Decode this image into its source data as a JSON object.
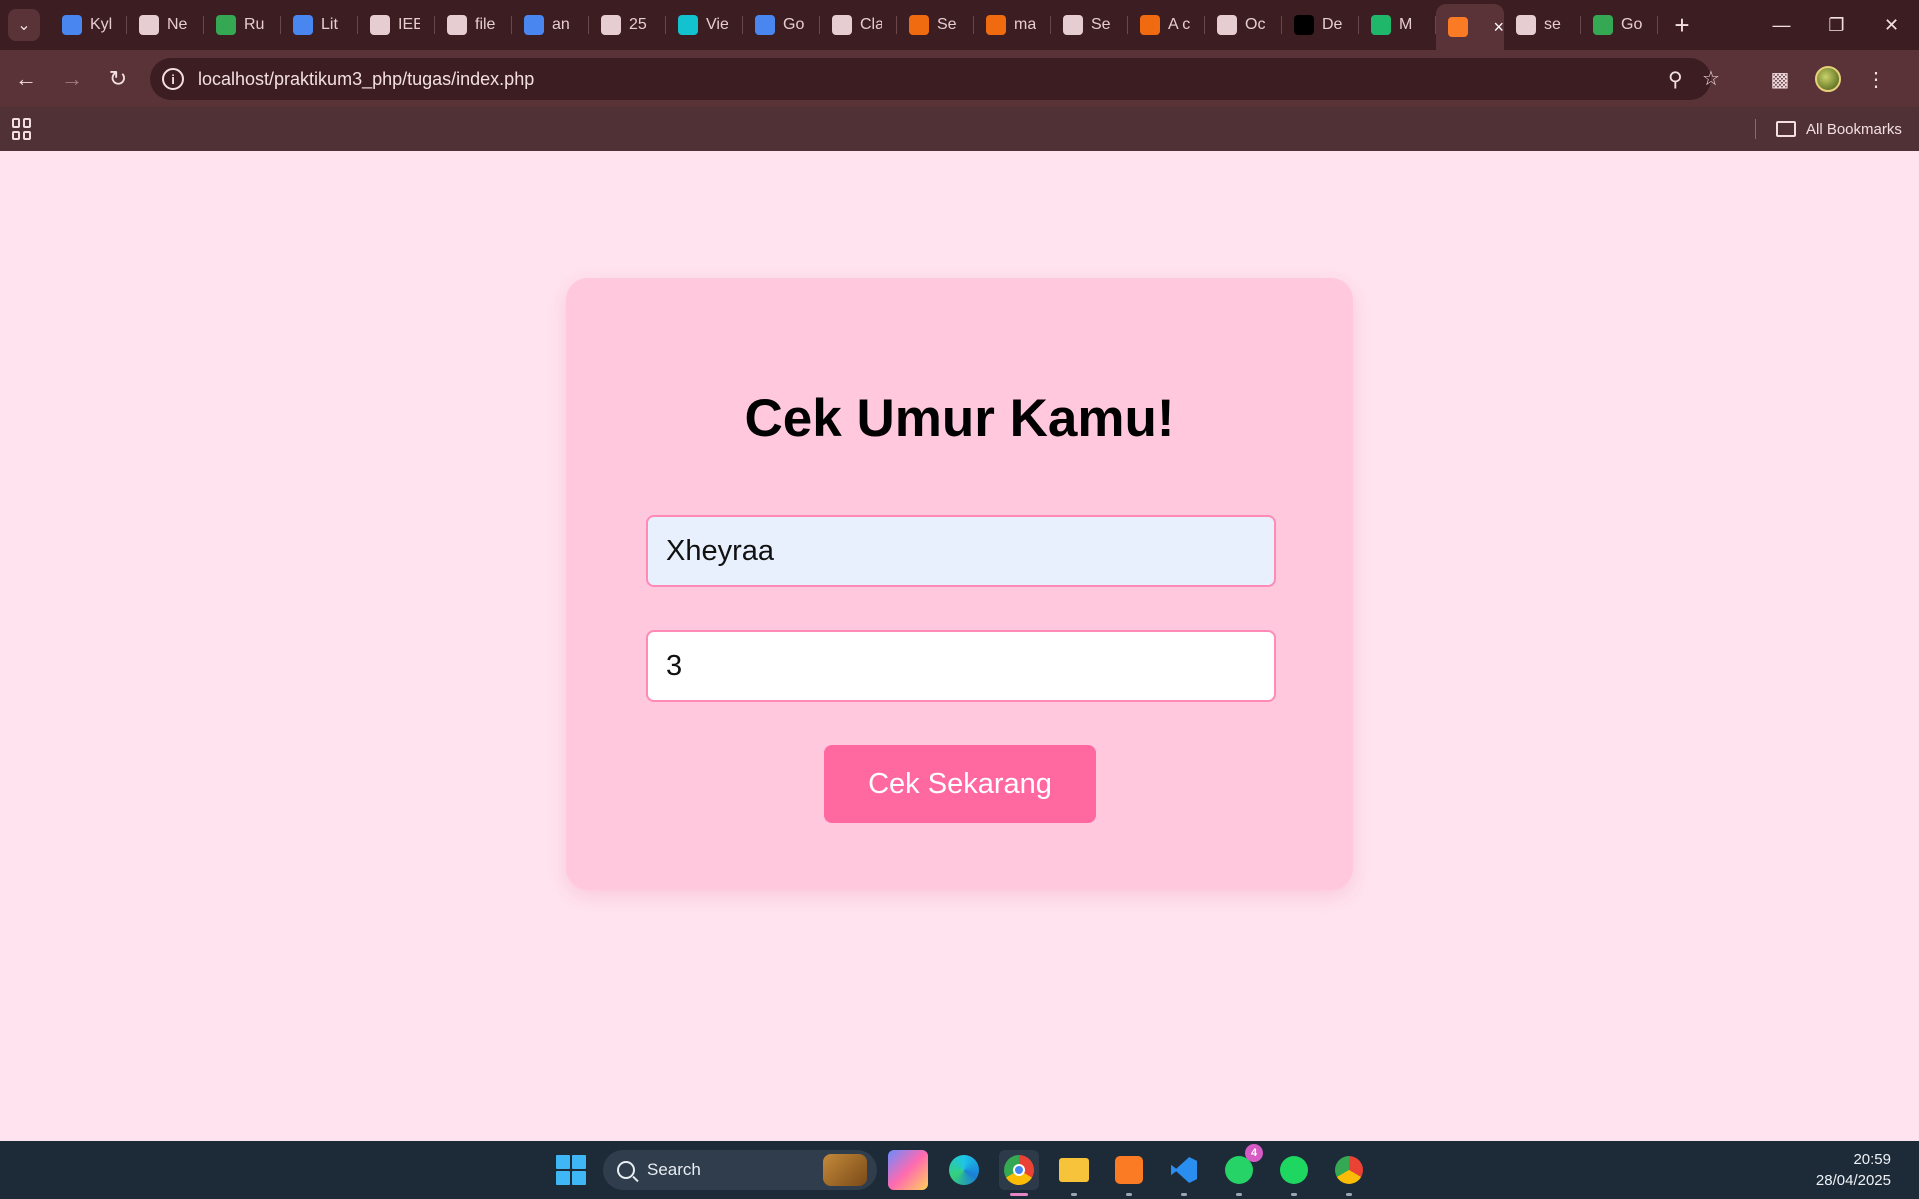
{
  "browser": {
    "tabs": [
      {
        "label": "Kyl",
        "icon": "google-docs-icon",
        "color": "#4a86f0"
      },
      {
        "label": "Ne",
        "icon": "chrome-icon",
        "color": "#e6cdd1"
      },
      {
        "label": "Ru",
        "icon": "google-drive-icon",
        "color": "#34a853"
      },
      {
        "label": "Lit",
        "icon": "google-docs-icon",
        "color": "#4a86f0"
      },
      {
        "label": "IEE",
        "icon": "globe-icon",
        "color": "#e6cdd1"
      },
      {
        "label": "file",
        "icon": "globe-icon",
        "color": "#e6cdd1"
      },
      {
        "label": "an",
        "icon": "classroom-icon",
        "color": "#4a86f0"
      },
      {
        "label": "25",
        "icon": "globe-icon",
        "color": "#e6cdd1"
      },
      {
        "label": "Vie",
        "icon": "canva-icon",
        "color": "#12c2cf"
      },
      {
        "label": "Go",
        "icon": "google-translate-icon",
        "color": "#4a86f0"
      },
      {
        "label": "Cla",
        "icon": "globe-icon",
        "color": "#e6cdd1"
      },
      {
        "label": "Se",
        "icon": "e-icon",
        "color": "#f06a10"
      },
      {
        "label": "ma",
        "icon": "e-icon",
        "color": "#f06a10"
      },
      {
        "label": "Se",
        "icon": "globe-icon",
        "color": "#e6cdd1"
      },
      {
        "label": "A c",
        "icon": "e-icon",
        "color": "#f06a10"
      },
      {
        "label": "Oc",
        "icon": "globe-icon",
        "color": "#e6cdd1"
      },
      {
        "label": "De",
        "icon": "x-icon",
        "color": "#000000"
      },
      {
        "label": "M",
        "icon": "zotero-icon",
        "color": "#1fb86a"
      },
      {
        "label": "",
        "icon": "xampp-icon",
        "color": "#fb7a24",
        "active": true
      },
      {
        "label": "se",
        "icon": "globe-icon",
        "color": "#e6cdd1"
      },
      {
        "label": "Go",
        "icon": "google-meet-icon",
        "color": "#34a853"
      }
    ],
    "url": "localhost/praktikum3_php/tugas/index.php",
    "all_bookmarks": "All Bookmarks"
  },
  "page": {
    "title": "Cek Umur Kamu!",
    "name_value": "Xheyraa",
    "age_value": "3",
    "submit_label": "Cek Sekarang"
  },
  "colors": {
    "page_bg": "#ffe4ef",
    "card_bg": "#ffc8dc",
    "button_bg": "#ff69a0",
    "input_border": "#ff8ab5"
  },
  "taskbar": {
    "search_label": "Search",
    "whatsapp_badge": "4",
    "time": "20:59",
    "date": "28/04/2025"
  }
}
